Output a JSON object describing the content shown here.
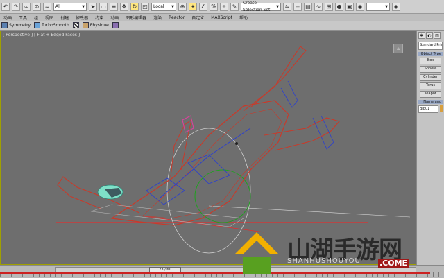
{
  "toolbar": {
    "filter_dropdown": "All",
    "coord_dropdown": "Local",
    "selection_set": "Create Selection Set",
    "icons": [
      "undo-icon",
      "redo-icon",
      "link-icon",
      "unlink-icon",
      "bind-icon",
      "select-icon",
      "select-region-icon",
      "select-by-name-icon",
      "move-icon",
      "rotate-icon",
      "scale-icon",
      "pivot-icon",
      "snap-icon",
      "angle-snap-icon",
      "mirror-icon",
      "align-icon",
      "layer-icon",
      "curve-icon",
      "schematic-icon",
      "material-icon",
      "render-setup-icon",
      "render-icon"
    ]
  },
  "menubar": {
    "items": [
      "动画",
      "工具",
      "组",
      "视图",
      "创建",
      "修改器",
      "约束",
      "动画",
      "图形编辑器",
      "渲染",
      "Reactor",
      "自定义",
      "MAXScript",
      "帮助"
    ]
  },
  "modbar": {
    "items": [
      "Symmetry",
      "TurboSmooth",
      "Physique"
    ]
  },
  "viewport": {
    "label": "[ Perspective ] [ Flat + Edged Faces ]"
  },
  "command_panel": {
    "category_dropdown": "Standard Primitives",
    "rollout_object_type": "Object Type",
    "object_buttons": [
      "Box",
      "Sphere",
      "Cylinder",
      "Torus",
      "Teapot"
    ],
    "rollout_name": "Name and Color",
    "object_name": "Bip01"
  },
  "timeline": {
    "frame_readout": "23 / 60",
    "current_frame": 23,
    "total_frames": 60
  },
  "watermark": {
    "chinese": "山湖手游网",
    "pinyin": "SHANHUSHOUYOU",
    "domain": ".COME"
  }
}
